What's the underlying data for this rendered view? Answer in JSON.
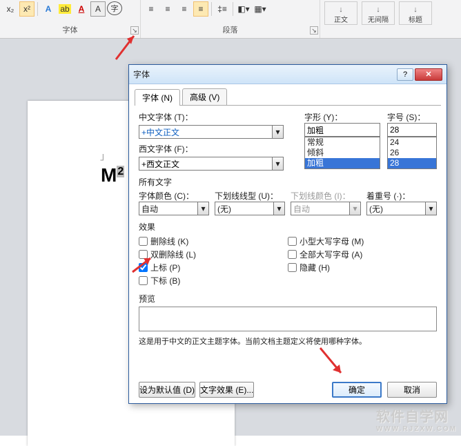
{
  "ribbon": {
    "group_font_label": "字体",
    "group_para_label": "段落",
    "styles": {
      "body": "正文",
      "naked": "无间隔",
      "title": "标题",
      "accent": "↓"
    }
  },
  "doc": {
    "text": "M",
    "sup": "2"
  },
  "dialog": {
    "title": "字体",
    "tabs": {
      "font": "字体 (N)",
      "adv": "高级 (V)"
    },
    "cn_font_label": "中文字体 (T)：",
    "cn_font_value": "+中文正文",
    "style_label": "字形 (Y)：",
    "style_value": "加粗",
    "style_options": [
      "常规",
      "倾斜",
      "加粗"
    ],
    "size_label": "字号 (S)：",
    "size_value": "28",
    "size_options": [
      "24",
      "26",
      "28"
    ],
    "wn_font_label": "西文字体 (F)：",
    "wn_font_value": "+西文正文",
    "all_label": "所有文字",
    "font_color_label": "字体颜色 (C)：",
    "font_color_value": "自动",
    "underline_style_label": "下划线线型 (U)：",
    "underline_style_value": "(无)",
    "underline_color_label": "下划线颜色 (I)：",
    "underline_color_value": "自动",
    "emphasis_label": "着重号 (·)：",
    "emphasis_value": "(无)",
    "effects_label": "效果",
    "chk_strike": "删除线 (K)",
    "chk_dstrike": "双删除线 (L)",
    "chk_super": "上标 (P)",
    "chk_sub": "下标 (B)",
    "chk_smallcaps": "小型大写字母 (M)",
    "chk_allcaps": "全部大写字母 (A)",
    "chk_hidden": "隐藏 (H)",
    "preview_label": "预览",
    "preview_text": " ",
    "helper_text": "这是用于中文的正文主题字体。当前文档主题定义将使用哪种字体。",
    "btn_default": "设为默认值 (D)",
    "btn_effects": "文字效果 (E)...",
    "btn_ok": "确定",
    "btn_cancel": "取消"
  },
  "watermark": {
    "main": "软件自学网",
    "sub": "WWW.RJZXW.COM"
  }
}
